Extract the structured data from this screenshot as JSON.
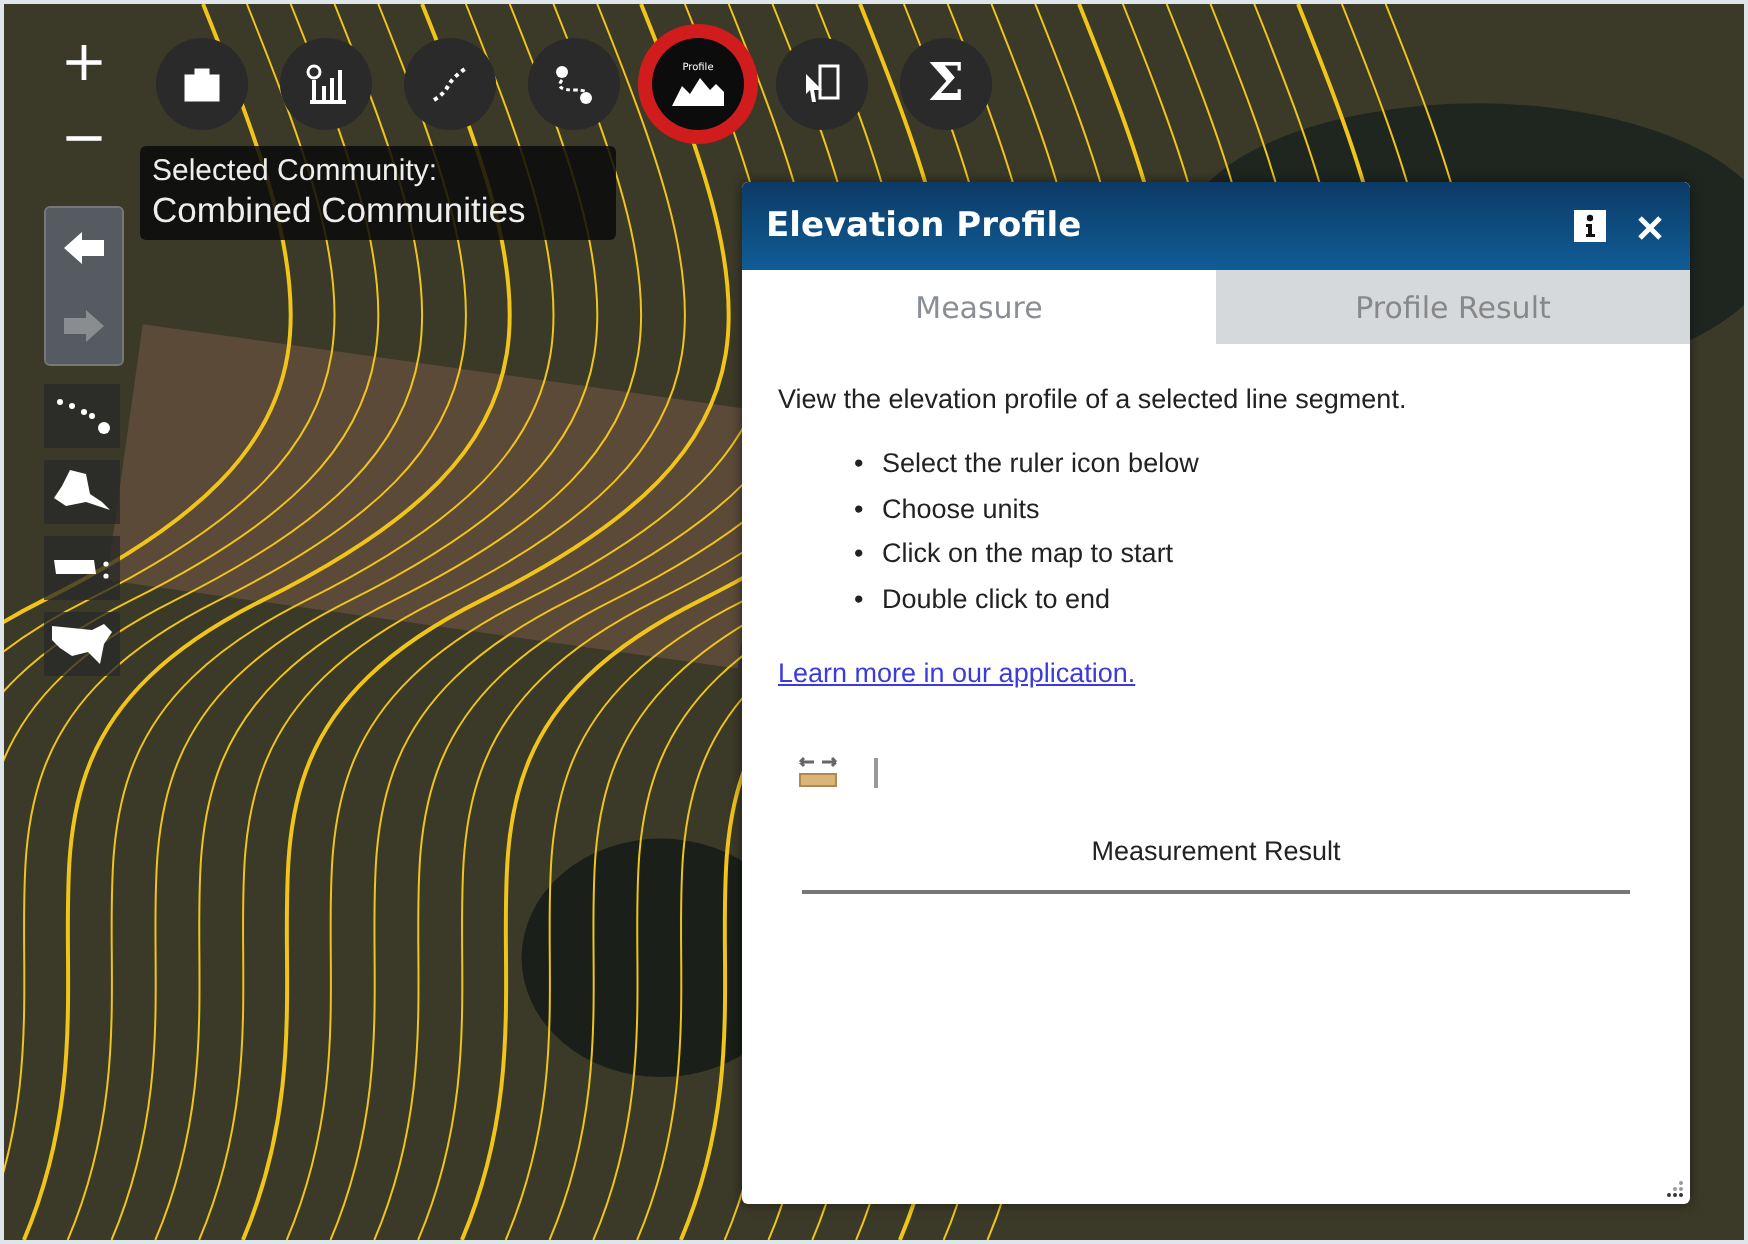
{
  "map": {
    "zoom_in": "+",
    "zoom_out": "−"
  },
  "toolbar": [
    {
      "kind": "toolbox",
      "selected": false
    },
    {
      "kind": "chart",
      "selected": false
    },
    {
      "kind": "path",
      "selected": false
    },
    {
      "kind": "route",
      "selected": false
    },
    {
      "kind": "profile",
      "selected": true,
      "label": "Profile"
    },
    {
      "kind": "select",
      "selected": false
    },
    {
      "kind": "sum",
      "selected": false,
      "label": "Σ"
    }
  ],
  "tooltip": {
    "title": "Selected Community:",
    "value": "Combined Communities"
  },
  "navigation": [
    {
      "kind": "back",
      "disabled": false
    },
    {
      "kind": "forward",
      "disabled": true
    }
  ],
  "regions": [
    {
      "kind": "hawaii"
    },
    {
      "kind": "alaska"
    },
    {
      "kind": "puerto-rico"
    },
    {
      "kind": "usa"
    }
  ],
  "panel": {
    "title": "Elevation Profile",
    "tabs": [
      {
        "label": "Measure",
        "selected": true
      },
      {
        "label": "Profile Result",
        "selected": false
      }
    ],
    "intro": "View the elevation profile of a selected line segment.",
    "bullet": "•",
    "steps": [
      "Select the ruler icon below",
      "Choose units",
      "Click on the map to start",
      "Double click to end"
    ],
    "link": "Learn more in our application.",
    "result_heading": "Measurement Result"
  }
}
